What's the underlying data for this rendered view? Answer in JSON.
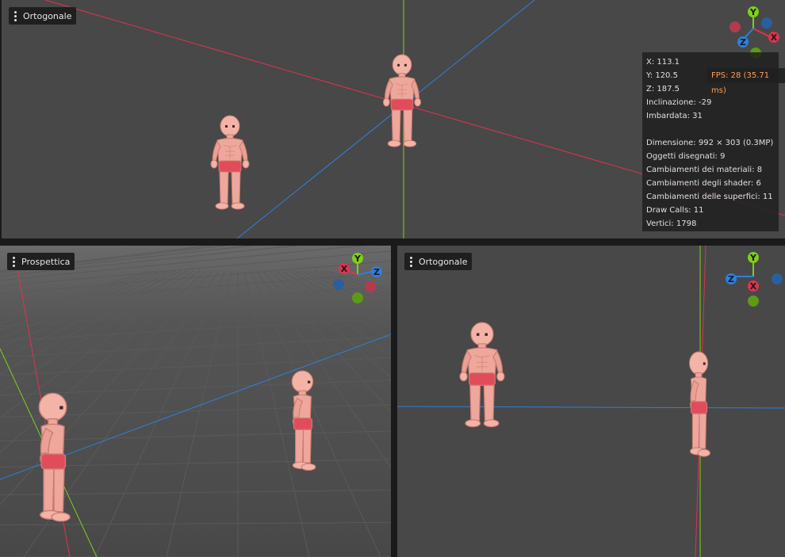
{
  "viewports": {
    "top": {
      "mode_label": "Ortogonale"
    },
    "bottom_left": {
      "mode_label": "Prospettica"
    },
    "bottom_right": {
      "mode_label": "Ortogonale"
    }
  },
  "gizmo_labels": {
    "x": "X",
    "y": "Y",
    "z": "Z"
  },
  "stats": {
    "x": "X: 113.1",
    "y": "Y: 120.5",
    "z": "Z: 187.5",
    "pitch": "Inclinazione: -29",
    "yaw": "Imbardata: 31",
    "size": "Dimensione: 992 × 303 (0.3MP)",
    "objects": "Oggetti disegnati: 9",
    "material_changes": "Cambiamenti dei materiali: 8",
    "shader_changes": "Cambiamenti degli shader: 6",
    "surface_changes": "Cambiamenti delle superfici: 11",
    "draw_calls": "Draw Calls: 11",
    "vertices": "Vertici: 1798",
    "fps": "FPS: 28 (35.71 ms)"
  },
  "colors": {
    "axis_x": "#e0324f",
    "axis_y": "#7fcf19",
    "axis_z": "#2e7fdf",
    "viewport_bg": "#484848",
    "panel_bg": "#1f1f1f",
    "fps_text": "#ff9f55",
    "skin": "#efa69b",
    "shorts": "#e24c5a"
  }
}
